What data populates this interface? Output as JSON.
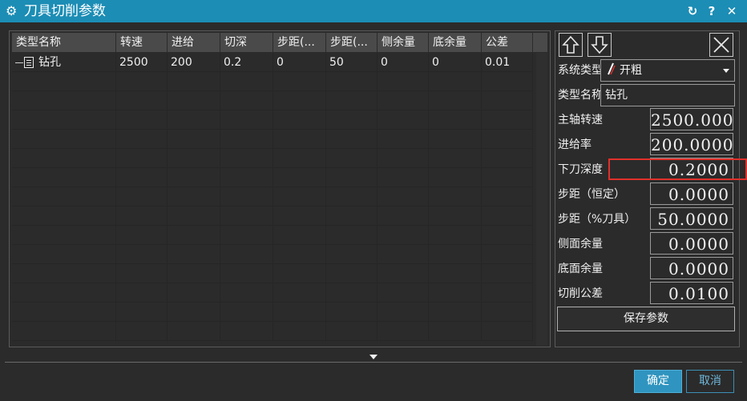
{
  "window": {
    "title": "刀具切削参数",
    "title_icon": "gear-icon",
    "refresh_icon": "refresh-icon",
    "help_label": "?",
    "close_label": "✕",
    "accent_color": "#1c8db5"
  },
  "table": {
    "columns": [
      "类型名称",
      "转速",
      "进给",
      "切深",
      "步距(...",
      "步距(...",
      "侧余量",
      "底余量",
      "公差"
    ],
    "rows": [
      {
        "name": "钻孔",
        "speed": "2500",
        "feed": "200",
        "depth": "0.2",
        "step1": "0",
        "step2": "50",
        "side": "0",
        "bottom": "0",
        "tol": "0.01"
      }
    ]
  },
  "side": {
    "up_icon": "arrow-up-icon",
    "down_icon": "arrow-down-icon",
    "close_icon": "close-icon",
    "system_type_label": "系统类型",
    "system_type_value": "开粗",
    "type_name_label": "类型名称",
    "type_name_value": "钻孔",
    "params": [
      {
        "label": "主轴转速",
        "value": "2500.000"
      },
      {
        "label": "进给率",
        "value": "200.0000"
      },
      {
        "label": "下刀深度",
        "value": "0.2000"
      },
      {
        "label": "步距（恒定）",
        "value": "0.0000"
      },
      {
        "label": "步距（%刀具）",
        "value": "50.0000"
      },
      {
        "label": "侧面余量",
        "value": "0.0000"
      },
      {
        "label": "底面余量",
        "value": "0.0000"
      },
      {
        "label": "切削公差",
        "value": "0.0100"
      }
    ],
    "save_label": "保存参数",
    "highlight_color": "#e0302b"
  },
  "footer": {
    "ok_label": "确定",
    "cancel_label": "取消"
  }
}
